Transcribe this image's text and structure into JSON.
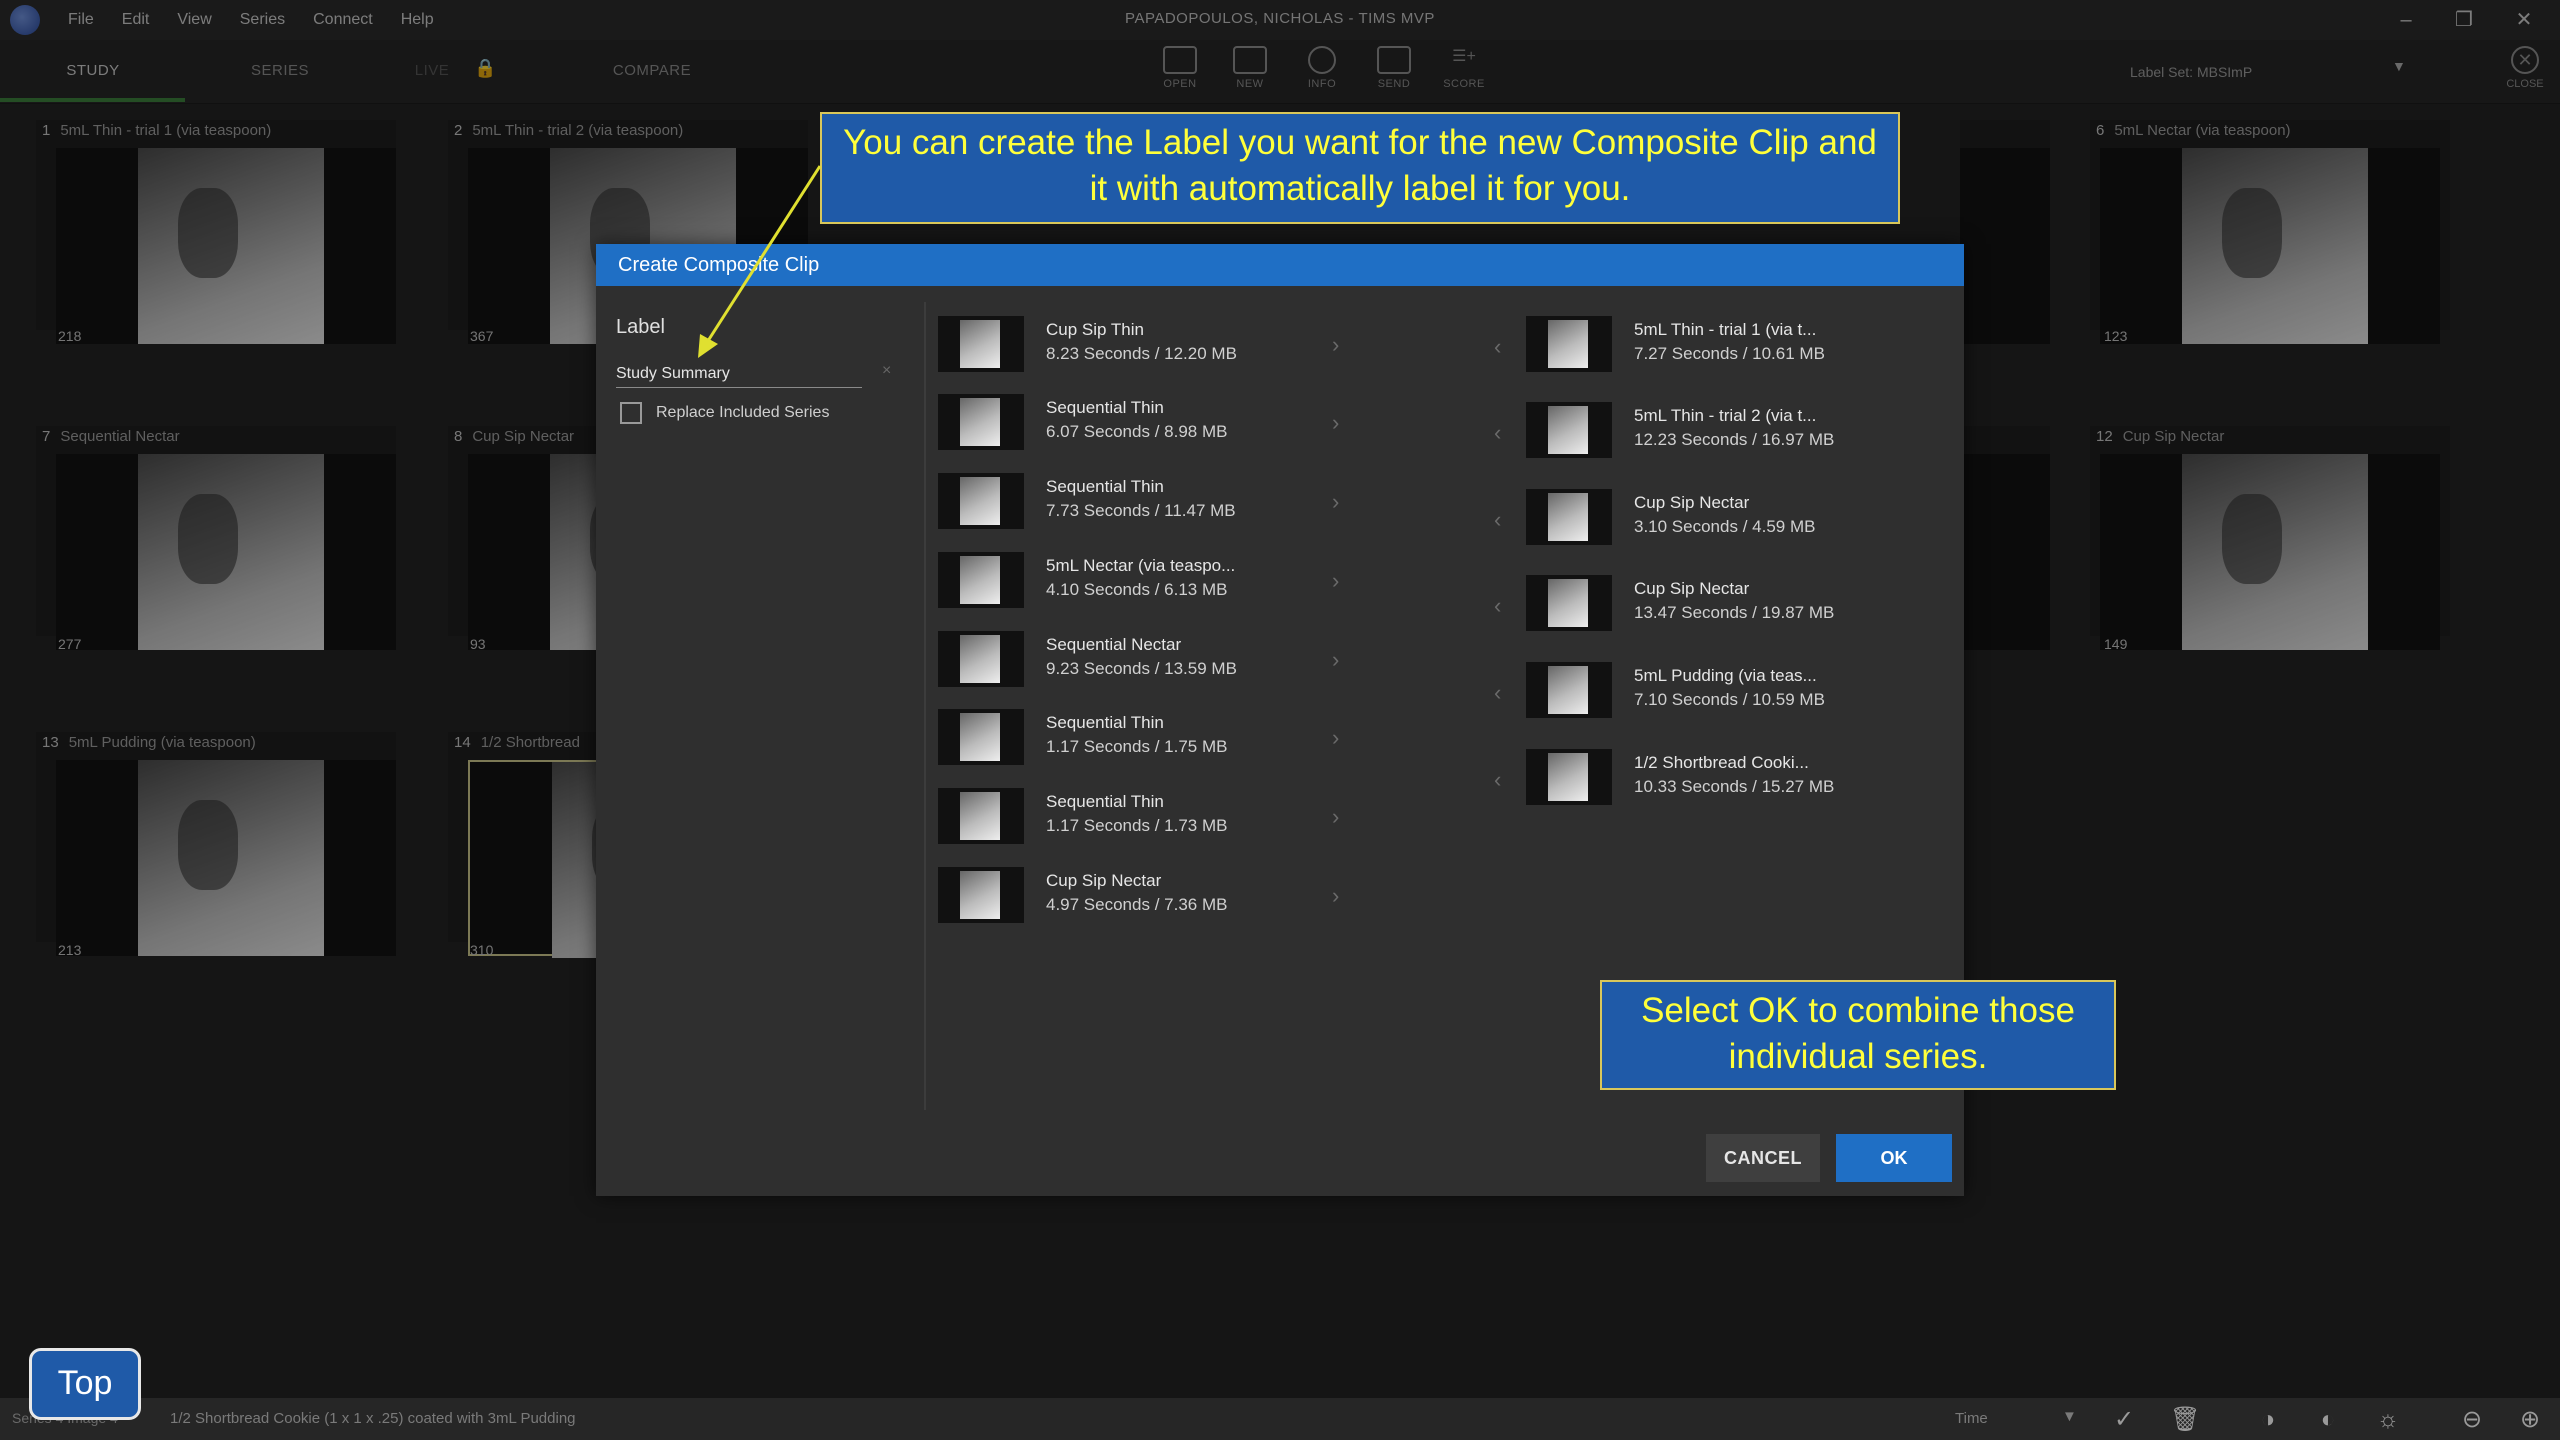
{
  "menu": [
    "File",
    "Edit",
    "View",
    "Series",
    "Connect",
    "Help"
  ],
  "window_title": "PAPADOPOULOS, NICHOLAS - TIMS MVP",
  "tabs": {
    "study": "STUDY",
    "series": "SERIES",
    "live": "LIVE",
    "compare": "COMPARE"
  },
  "toolbar": {
    "open": "OPEN",
    "new": "NEW",
    "info": "INFO",
    "send": "SEND",
    "score": "SCORE",
    "close": "CLOSE",
    "label_set": "Label Set: MBSImP"
  },
  "tiles": [
    {
      "num": "1",
      "title": "5mL Thin - trial 1 (via teaspoon)",
      "count": "218"
    },
    {
      "num": "2",
      "title": "5mL Thin - trial 2 (via teaspoon)",
      "count": "367"
    },
    {
      "num": "6",
      "title": "5mL Nectar (via teaspoon)",
      "count": "123"
    },
    {
      "num": "7",
      "title": "Sequential Nectar",
      "count": "277"
    },
    {
      "num": "8",
      "title": "Cup Sip Nectar",
      "count": "93"
    },
    {
      "num": "12",
      "title": "Cup Sip Nectar",
      "count": "149"
    },
    {
      "num": "13",
      "title": "5mL Pudding (via teaspoon)",
      "count": "213"
    },
    {
      "num": "14",
      "title": "1/2 Shortbread",
      "count": "310"
    }
  ],
  "dialog": {
    "title": "Create Composite Clip",
    "label_heading": "Label",
    "label_value": "Study Summary",
    "replace_label": "Replace Included Series",
    "cancel": "CANCEL",
    "ok": "OK",
    "left_list": [
      {
        "name": "Cup Sip Thin",
        "meta": "8.23 Seconds / 12.20 MB"
      },
      {
        "name": "Sequential Thin",
        "meta": "6.07 Seconds / 8.98 MB"
      },
      {
        "name": "Sequential Thin",
        "meta": "7.73 Seconds / 11.47 MB"
      },
      {
        "name": "5mL Nectar (via teaspo...",
        "meta": "4.10 Seconds / 6.13 MB"
      },
      {
        "name": "Sequential Nectar",
        "meta": "9.23 Seconds / 13.59 MB"
      },
      {
        "name": "Sequential Thin",
        "meta": "1.17 Seconds / 1.75 MB"
      },
      {
        "name": "Sequential Thin",
        "meta": "1.17 Seconds / 1.73 MB"
      },
      {
        "name": "Cup Sip Nectar",
        "meta": "4.97 Seconds / 7.36 MB"
      }
    ],
    "right_list": [
      {
        "name": "5mL Thin - trial 1 (via t...",
        "meta": "7.27 Seconds / 10.61 MB"
      },
      {
        "name": "5mL Thin - trial 2 (via t...",
        "meta": "12.23 Seconds / 16.97 MB"
      },
      {
        "name": "Cup Sip Nectar",
        "meta": "3.10 Seconds / 4.59 MB"
      },
      {
        "name": "Cup Sip Nectar",
        "meta": "13.47 Seconds / 19.87 MB"
      },
      {
        "name": "5mL Pudding (via teas...",
        "meta": "7.10 Seconds / 10.59 MB"
      },
      {
        "name": "1/2 Shortbread Cooki...",
        "meta": "10.33 Seconds / 15.27 MB"
      }
    ]
  },
  "callouts": {
    "label_tip": "You can create the Label you want for the new Composite Clip and it with automatically label it for you.",
    "ok_tip": "Select OK to combine those individual series."
  },
  "status": {
    "left": "Series 4 Image 4",
    "text": "1/2 Shortbread Cookie (1 x 1 x .25) coated with 3mL Pudding",
    "time_label": "Time"
  },
  "top_button": "Top",
  "colors": {
    "accent_blue": "#1f6fc5",
    "callout_bg": "#1f5aa8",
    "callout_text": "#ffff3a",
    "arrow": "#e0e030",
    "active_tab": "#3a7d3a"
  }
}
